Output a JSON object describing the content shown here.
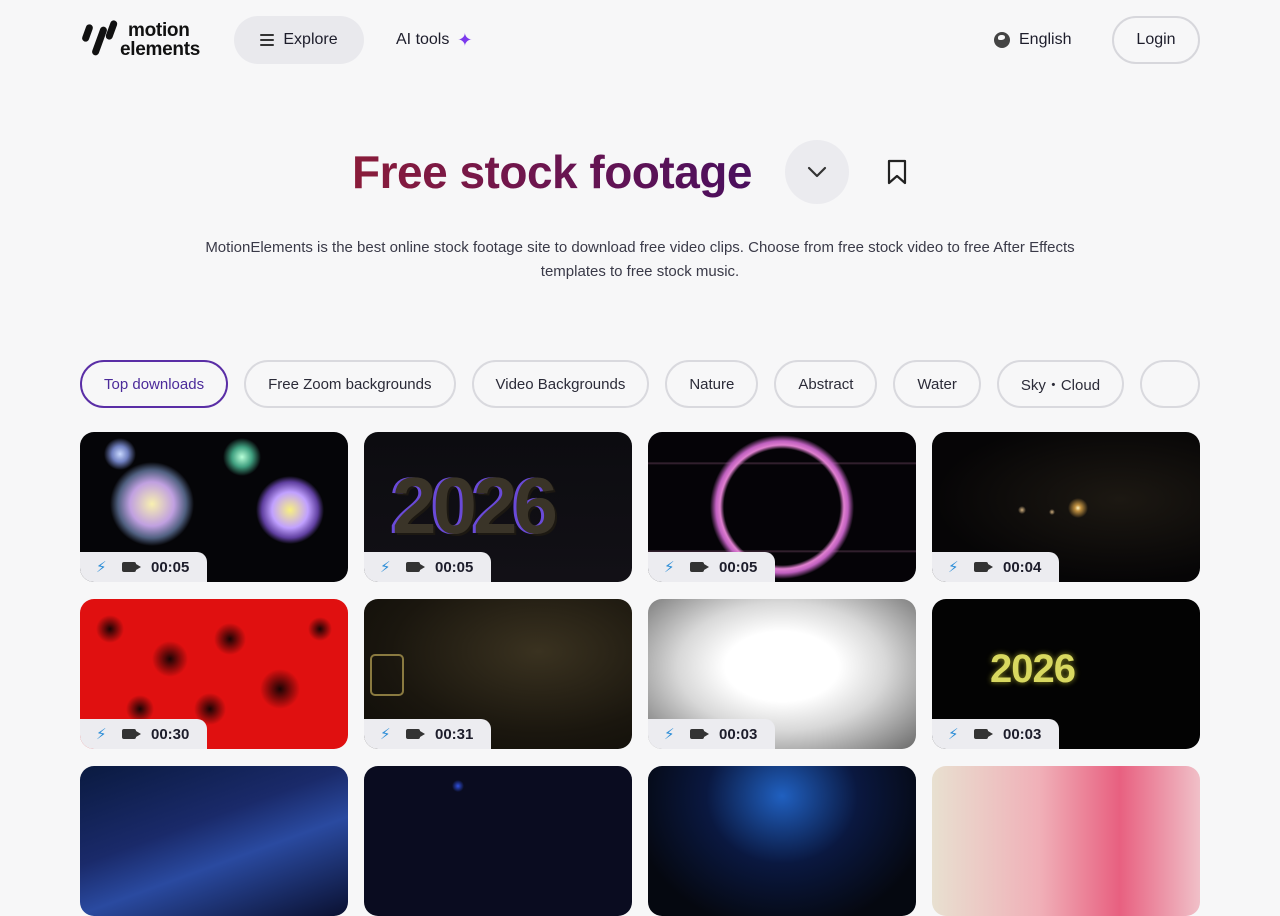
{
  "header": {
    "logo_line1": "motion",
    "logo_line2": "elements",
    "explore_label": "Explore",
    "ai_tools_label": "AI tools",
    "language_label": "English",
    "login_label": "Login"
  },
  "hero": {
    "title": "Free stock footage",
    "description": "MotionElements is the best online stock footage site to download free video clips. Choose from free stock video to free After Effects templates to free stock music."
  },
  "chips": [
    {
      "label": "Top downloads",
      "active": true
    },
    {
      "label": "Free Zoom backgrounds"
    },
    {
      "label": "Video Backgrounds"
    },
    {
      "label": "Nature"
    },
    {
      "label": "Abstract"
    },
    {
      "label": "Water"
    },
    {
      "label": "Sky・Cloud"
    },
    {
      "label": ""
    }
  ],
  "cards": [
    {
      "duration": "00:05",
      "thumb": "fireworks"
    },
    {
      "duration": "00:05",
      "thumb": "2026-3d"
    },
    {
      "duration": "00:05",
      "thumb": "sparkle-ring"
    },
    {
      "duration": "00:04",
      "thumb": "light-particles"
    },
    {
      "duration": "00:30",
      "thumb": "red-abstract"
    },
    {
      "duration": "00:31",
      "thumb": "dark-film"
    },
    {
      "duration": "00:03",
      "thumb": "speed-lines"
    },
    {
      "duration": "00:03",
      "thumb": "2026-gold"
    },
    {
      "duration": "",
      "thumb": "blue-light"
    },
    {
      "duration": "",
      "thumb": "dark-bokeh"
    },
    {
      "duration": "",
      "thumb": "blue-glitter"
    },
    {
      "duration": "",
      "thumb": "flowers"
    }
  ],
  "colors": {
    "accent": "#5a2ea6",
    "title_gradient_start": "#8a1c3a",
    "title_gradient_end": "#4a0f5e",
    "bolt": "#2f8fd8",
    "ai_spark": "#7c3aed"
  }
}
